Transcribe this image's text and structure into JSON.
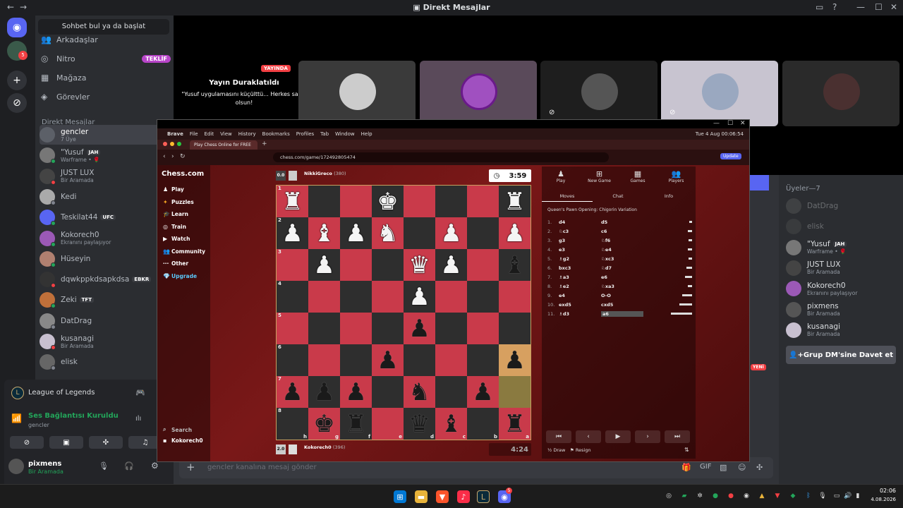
{
  "window": {
    "title": "Direkt Mesajlar"
  },
  "sidebar": {
    "search_label": "Sohbet bul ya da başlat",
    "menu": [
      {
        "label": "Arkadaşlar",
        "icon": "people-icon"
      },
      {
        "label": "Nitro",
        "icon": "nitro-icon",
        "badge": "TEKLİF"
      },
      {
        "label": "Mağaza",
        "icon": "shop-icon"
      },
      {
        "label": "Görevler",
        "icon": "quests-icon"
      }
    ],
    "dm_header": "Direkt Mesajlar",
    "dms": [
      {
        "name": "gencler",
        "sub": "7 Üye",
        "color": "#5c6068"
      },
      {
        "name": "\"Yusuf",
        "tag": "JAH",
        "sub": "Warframe • 🌹",
        "color": "#777",
        "status": "#23a55a"
      },
      {
        "name": "JUST LUX",
        "sub": "Bir Aramada",
        "color": "#444",
        "status": "#f23f43"
      },
      {
        "name": "Kedi",
        "sub": "",
        "color": "#aaa",
        "status": "#80848e"
      },
      {
        "name": "Teskilat44",
        "tag": "UFC",
        "sub": "",
        "color": "#5865f2",
        "status": "#23a55a"
      },
      {
        "name": "Kokorech0",
        "sub": "Ekranını paylaşıyor",
        "color": "#9b59b6",
        "status": "#23a55a"
      },
      {
        "name": "Hüseyin",
        "sub": "",
        "color": "#b08070",
        "status": "#23a55a"
      },
      {
        "name": "dqwkppkdsapkdsa",
        "tag": "EBKR",
        "sub": "",
        "color": "#333",
        "status": "#f23f43"
      },
      {
        "name": "Zeki",
        "tag": "TFT",
        "sub": "",
        "color": "#c0703a",
        "status": "#23a55a"
      },
      {
        "name": "DatDrag",
        "sub": "",
        "color": "#888",
        "status": "#80848e"
      },
      {
        "name": "kusanagi",
        "sub": "Bir Aramada",
        "color": "#c8c0d0",
        "status": "#f23f43"
      },
      {
        "name": "elisk",
        "sub": "",
        "color": "#666",
        "status": "#80848e"
      }
    ]
  },
  "activity": {
    "game": "League of Legends",
    "voice_status": "Ses Bağlantısı Kuruldu",
    "voice_channel": "gencler",
    "user_name": "pixmens",
    "user_status": "Bir Aramada"
  },
  "stream": {
    "live_badge": "YAYINDA",
    "paused_title": "Yayın Duraklatıldı",
    "paused_msg": "\"Yusuf uygulamasını küçülttü... Herkes sakin olsun!"
  },
  "members": {
    "header": "Üyeler—7",
    "list": [
      {
        "name": "DatDrag",
        "sub": "",
        "dim": true
      },
      {
        "name": "elisk",
        "sub": "",
        "dim": true
      },
      {
        "name": "\"Yusuf",
        "tag": "JAH",
        "sub": "Warframe • 🌹"
      },
      {
        "name": "JUST LUX",
        "sub": "Bir Aramada"
      },
      {
        "name": "Kokorech0",
        "sub": "Ekranını paylaşıyor"
      },
      {
        "name": "pixmens",
        "sub": "Bir Aramada"
      },
      {
        "name": "kusanagi",
        "sub": "Bir Aramada"
      }
    ],
    "invite_label": "Grup DM'sine Davet et"
  },
  "chat": {
    "placeholder": "gencler kanalına mesaj gönder",
    "new_badge": "YENİ"
  },
  "chess": {
    "mac_menu": [
      "Brave",
      "File",
      "Edit",
      "View",
      "History",
      "Bookmarks",
      "Profiles",
      "Tab",
      "Window",
      "Help"
    ],
    "clock_text": "Tue 4 Aug 00:06:54",
    "tab_title": "Play Chess Online for FREE",
    "url": "chess.com/game/172492805474",
    "update_btn": "Update",
    "logo": "Chess.com",
    "nav": [
      "Play",
      "Puzzles",
      "Learn",
      "Train",
      "Watch",
      "Community",
      "Other",
      "Upgrade"
    ],
    "search_label": "Search",
    "nav_user": "Kokorech0",
    "top_player": {
      "eval": "0.0",
      "name": "NikkiGreco",
      "rating": "(380)",
      "timer": "3:59"
    },
    "bottom_player": {
      "eval": "2.0",
      "name": "Kokorech0",
      "rating": "(396)",
      "timer": "4:24"
    },
    "panel_tabs": [
      "Play",
      "New Game",
      "Games",
      "Players"
    ],
    "sub_tabs": [
      "Moves",
      "Chat",
      "Info"
    ],
    "opening": "Queen's Pawn Opening: Chigorin Variation",
    "moves": [
      [
        "1.",
        "d4",
        "d5"
      ],
      [
        "2.",
        "♘c3",
        "c6"
      ],
      [
        "3.",
        "g3",
        "♘f6"
      ],
      [
        "4.",
        "e3",
        "♘e4"
      ],
      [
        "5.",
        "♗g2",
        "♘xc3"
      ],
      [
        "6.",
        "bxc3",
        "♘d7"
      ],
      [
        "7.",
        "♗a3",
        "e6"
      ],
      [
        "8.",
        "♗e2",
        "♘xa3"
      ],
      [
        "9.",
        "e4",
        "O-O"
      ],
      [
        "10.",
        "exd5",
        "cxd5"
      ],
      [
        "11.",
        "♗d3",
        "a6"
      ]
    ],
    "draw_label": "Draw",
    "resign_label": "Resign",
    "board": [
      [
        "wr",
        "",
        "",
        "wk",
        "",
        "",
        "",
        "wr"
      ],
      [
        "wp",
        "wb",
        "wp",
        "wn",
        "",
        "wp",
        "",
        "wp"
      ],
      [
        "",
        "wp",
        "",
        "",
        "wq",
        "wp",
        "",
        "bb"
      ],
      [
        "",
        "",
        "",
        "",
        "wp",
        "",
        "",
        ""
      ],
      [
        "",
        "",
        "",
        "",
        "bp",
        "",
        "",
        ""
      ],
      [
        "",
        "",
        "",
        "bp",
        "",
        "",
        "",
        "bp"
      ],
      [
        "bp",
        "bp",
        "bp",
        "",
        "bn",
        "",
        "bp",
        ""
      ],
      [
        "",
        "bk",
        "br",
        "",
        "bq",
        "bb",
        "",
        "br"
      ]
    ],
    "ranks": [
      "1",
      "2",
      "3",
      "4",
      "5",
      "6",
      "7",
      "8"
    ],
    "files": [
      "h",
      "g",
      "f",
      "e",
      "d",
      "c",
      "b",
      "a"
    ]
  },
  "taskbar": {
    "time": "02:06",
    "date": "4.08.2026"
  }
}
